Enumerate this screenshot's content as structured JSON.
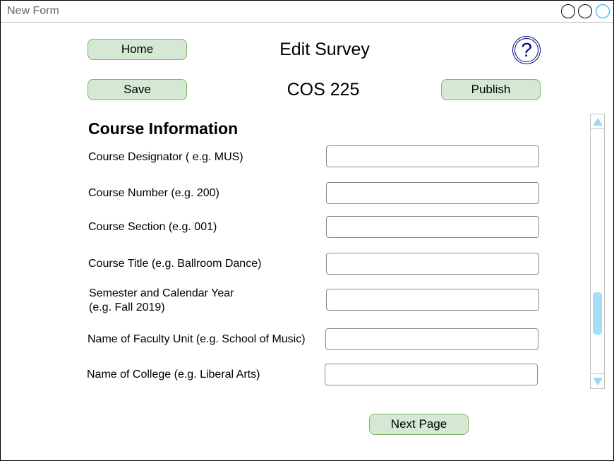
{
  "window": {
    "title": "New Form"
  },
  "header": {
    "home_label": "Home",
    "page_title": "Edit Survey",
    "help_symbol": "?",
    "save_label": "Save",
    "course_code": "COS 225",
    "publish_label": "Publish"
  },
  "form": {
    "section_title": "Course Information",
    "fields": [
      {
        "label": "Course Designator ( e.g. MUS)",
        "value": ""
      },
      {
        "label": "Course Number (e.g. 200)",
        "value": ""
      },
      {
        "label": "Course Section (e.g. 001)",
        "value": ""
      },
      {
        "label": "Course Title (e.g. Ballroom Dance)",
        "value": ""
      },
      {
        "label_line1": "Semester and Calendar Year",
        "label_line2": "(e.g. Fall 2019)",
        "value": ""
      },
      {
        "label": "Name of Faculty Unit (e.g. School of Music)",
        "value": ""
      },
      {
        "label": "Name of College (e.g. Liberal Arts)",
        "value": ""
      }
    ]
  },
  "footer": {
    "next_label": "Next Page"
  },
  "colors": {
    "button_fill": "#d5e8d4",
    "button_border": "#82b366",
    "help_color": "#000080",
    "scroll_accent": "#a8ddf7"
  },
  "scrollbar": {
    "position_fraction": 0.7
  }
}
